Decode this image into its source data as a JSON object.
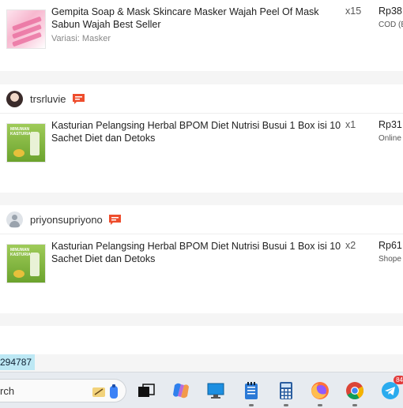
{
  "orders": [
    {
      "username": "",
      "product": {
        "name": "Gempita Soap & Mask Skincare Masker Wajah Peel Of Mask Sabun Wajah Best Seller",
        "variation": "Variasi: Masker",
        "quantity": "x15",
        "price": "Rp38.",
        "payment": "COD (B"
      }
    },
    {
      "username": "trsrluvie",
      "product": {
        "name": "Kasturian Pelangsing Herbal BPOM Diet Nutrisi Busui 1 Box isi 10 Sachet Diet dan Detoks",
        "variation": "",
        "quantity": "x1",
        "price": "Rp31.",
        "payment": "Online"
      },
      "thumb_label": "MINUMAN KASTURIAN"
    },
    {
      "username": "priyonsupriyono",
      "product": {
        "name": "Kasturian Pelangsing Herbal BPOM Diet Nutrisi Busui 1 Box isi 10 Sachet Diet dan Detoks",
        "variation": "",
        "quantity": "x2",
        "price": "Rp61.",
        "payment": "Shope"
      },
      "thumb_label": "MINUMAN KASTURIAN"
    }
  ],
  "tooltip": "294787",
  "taskbar": {
    "search_text": "rch",
    "icons": [
      "task-view-icon",
      "copilot-icon",
      "desktop-monitor-icon",
      "notepad-icon",
      "calculator-icon",
      "firefox-icon",
      "chrome-icon",
      "telegram-icon"
    ],
    "telegram_badge": "84"
  },
  "colors": {
    "chat_icon": "#ee4d2d",
    "taskbar_bg": "#e7ebf0",
    "tooltip_bg": "#bde8f4"
  }
}
